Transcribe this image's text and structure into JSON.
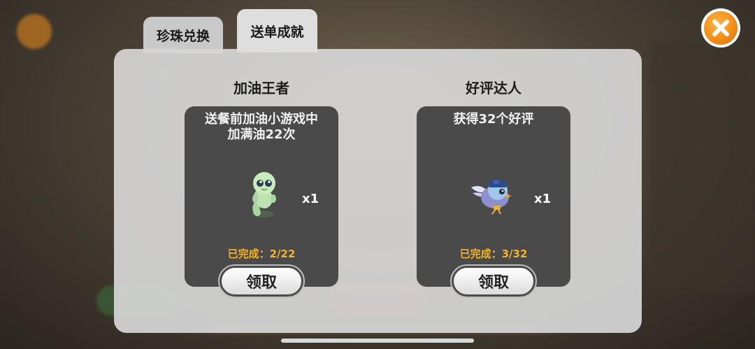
{
  "tabs": [
    {
      "label": "珍珠兑换",
      "active": false
    },
    {
      "label": "送单成就",
      "active": true
    }
  ],
  "achievements": [
    {
      "title": "加油王者",
      "description_line1": "送餐前加油小游戏中",
      "description_line2": "加满油22次",
      "reward_icon": "green-worm-pet-icon",
      "reward_qty": "x1",
      "progress": "已完成：2/22",
      "claim_label": "领取"
    },
    {
      "title": "好评达人",
      "description_line1": "获得32个好评",
      "description_line2": "",
      "reward_icon": "blue-bird-pet-icon",
      "reward_qty": "x1",
      "progress": "已完成：3/32",
      "claim_label": "领取"
    }
  ],
  "colors": {
    "progress": "#f5b422",
    "close": "#f28a12",
    "card": "#4a4a4a"
  }
}
